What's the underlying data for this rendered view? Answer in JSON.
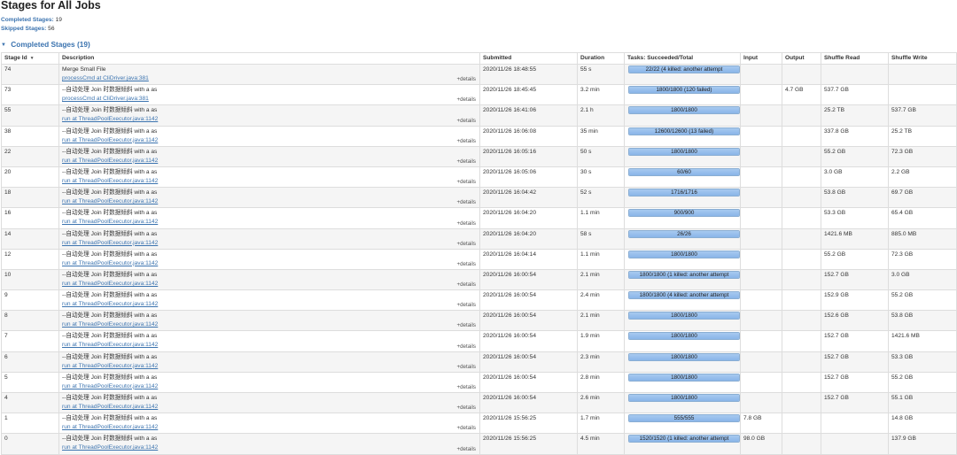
{
  "page": {
    "title": "Stages for All Jobs",
    "summary": [
      {
        "label": "Completed Stages:",
        "value": "19"
      },
      {
        "label": "Skipped Stages:",
        "value": "56"
      }
    ],
    "section_title": "Completed Stages (19)"
  },
  "table": {
    "columns": [
      "Stage Id",
      "Description",
      "Submitted",
      "Duration",
      "Tasks: Succeeded/Total",
      "Input",
      "Output",
      "Shuffle Read",
      "Shuffle Write"
    ],
    "details_label": "+details",
    "rows": [
      {
        "id": "74",
        "desc1": "Merge Small File",
        "desc2": "processCmd at CliDriver.java:381",
        "submitted": "2020/11/26 18:48:55",
        "duration": "55 s",
        "tasks": "22/22 (4 killed: another attempt",
        "progress": 1.0,
        "input": "",
        "output": "",
        "shuffle_read": "",
        "shuffle_write": ""
      },
      {
        "id": "73",
        "desc1": "--自动处理 Join 时数据倾斜 with a as",
        "desc2": "processCmd at CliDriver.java:381",
        "submitted": "2020/11/26 18:45:45",
        "duration": "3.2 min",
        "tasks": "1800/1800 (120 failed)",
        "progress": 1.0,
        "input": "",
        "output": "4.7 GB",
        "shuffle_read": "537.7 GB",
        "shuffle_write": ""
      },
      {
        "id": "55",
        "desc1": "--自动处理 Join 时数据倾斜 with a as",
        "desc2": "run at ThreadPoolExecutor.java:1142",
        "submitted": "2020/11/26 16:41:06",
        "duration": "2.1 h",
        "tasks": "1800/1800",
        "progress": 1.0,
        "input": "",
        "output": "",
        "shuffle_read": "25.2 TB",
        "shuffle_write": "537.7 GB"
      },
      {
        "id": "38",
        "desc1": "--自动处理 Join 时数据倾斜 with a as",
        "desc2": "run at ThreadPoolExecutor.java:1142",
        "submitted": "2020/11/26 16:06:08",
        "duration": "35 min",
        "tasks": "12600/12600 (13 failed)",
        "progress": 1.0,
        "input": "",
        "output": "",
        "shuffle_read": "337.8 GB",
        "shuffle_write": "25.2 TB"
      },
      {
        "id": "22",
        "desc1": "--自动处理 Join 时数据倾斜 with a as",
        "desc2": "run at ThreadPoolExecutor.java:1142",
        "submitted": "2020/11/26 16:05:16",
        "duration": "50 s",
        "tasks": "1800/1800",
        "progress": 1.0,
        "input": "",
        "output": "",
        "shuffle_read": "55.2 GB",
        "shuffle_write": "72.3 GB"
      },
      {
        "id": "20",
        "desc1": "--自动处理 Join 时数据倾斜 with a as",
        "desc2": "run at ThreadPoolExecutor.java:1142",
        "submitted": "2020/11/26 16:05:06",
        "duration": "30 s",
        "tasks": "60/60",
        "progress": 1.0,
        "input": "",
        "output": "",
        "shuffle_read": "3.0 GB",
        "shuffle_write": "2.2 GB"
      },
      {
        "id": "18",
        "desc1": "--自动处理 Join 时数据倾斜 with a as",
        "desc2": "run at ThreadPoolExecutor.java:1142",
        "submitted": "2020/11/26 16:04:42",
        "duration": "52 s",
        "tasks": "1716/1716",
        "progress": 1.0,
        "input": "",
        "output": "",
        "shuffle_read": "53.8 GB",
        "shuffle_write": "69.7 GB"
      },
      {
        "id": "16",
        "desc1": "--自动处理 Join 时数据倾斜 with a as",
        "desc2": "run at ThreadPoolExecutor.java:1142",
        "submitted": "2020/11/26 16:04:20",
        "duration": "1.1 min",
        "tasks": "900/900",
        "progress": 1.0,
        "input": "",
        "output": "",
        "shuffle_read": "53.3 GB",
        "shuffle_write": "65.4 GB"
      },
      {
        "id": "14",
        "desc1": "--自动处理 Join 时数据倾斜 with a as",
        "desc2": "run at ThreadPoolExecutor.java:1142",
        "submitted": "2020/11/26 16:04:20",
        "duration": "58 s",
        "tasks": "26/26",
        "progress": 1.0,
        "input": "",
        "output": "",
        "shuffle_read": "1421.6 MB",
        "shuffle_write": "885.0 MB"
      },
      {
        "id": "12",
        "desc1": "--自动处理 Join 时数据倾斜 with a as",
        "desc2": "run at ThreadPoolExecutor.java:1142",
        "submitted": "2020/11/26 16:04:14",
        "duration": "1.1 min",
        "tasks": "1800/1800",
        "progress": 1.0,
        "input": "",
        "output": "",
        "shuffle_read": "55.2 GB",
        "shuffle_write": "72.3 GB"
      },
      {
        "id": "10",
        "desc1": "--自动处理 Join 时数据倾斜 with a as",
        "desc2": "run at ThreadPoolExecutor.java:1142",
        "submitted": "2020/11/26 16:00:54",
        "duration": "2.1 min",
        "tasks": "1800/1800 (1 killed: another attempt",
        "progress": 1.0,
        "input": "",
        "output": "",
        "shuffle_read": "152.7 GB",
        "shuffle_write": "3.0 GB"
      },
      {
        "id": "9",
        "desc1": "--自动处理 Join 时数据倾斜 with a as",
        "desc2": "run at ThreadPoolExecutor.java:1142",
        "submitted": "2020/11/26 16:00:54",
        "duration": "2.4 min",
        "tasks": "1800/1800 (4 killed: another attempt",
        "progress": 1.0,
        "input": "",
        "output": "",
        "shuffle_read": "152.9 GB",
        "shuffle_write": "55.2 GB"
      },
      {
        "id": "8",
        "desc1": "--自动处理 Join 时数据倾斜 with a as",
        "desc2": "run at ThreadPoolExecutor.java:1142",
        "submitted": "2020/11/26 16:00:54",
        "duration": "2.1 min",
        "tasks": "1800/1800",
        "progress": 1.0,
        "input": "",
        "output": "",
        "shuffle_read": "152.6 GB",
        "shuffle_write": "53.8 GB"
      },
      {
        "id": "7",
        "desc1": "--自动处理 Join 时数据倾斜 with a as",
        "desc2": "run at ThreadPoolExecutor.java:1142",
        "submitted": "2020/11/26 16:00:54",
        "duration": "1.9 min",
        "tasks": "1800/1800",
        "progress": 1.0,
        "input": "",
        "output": "",
        "shuffle_read": "152.7 GB",
        "shuffle_write": "1421.6 MB"
      },
      {
        "id": "6",
        "desc1": "--自动处理 Join 时数据倾斜 with a as",
        "desc2": "run at ThreadPoolExecutor.java:1142",
        "submitted": "2020/11/26 16:00:54",
        "duration": "2.3 min",
        "tasks": "1800/1800",
        "progress": 1.0,
        "input": "",
        "output": "",
        "shuffle_read": "152.7 GB",
        "shuffle_write": "53.3 GB"
      },
      {
        "id": "5",
        "desc1": "--自动处理 Join 时数据倾斜 with a as",
        "desc2": "run at ThreadPoolExecutor.java:1142",
        "submitted": "2020/11/26 16:00:54",
        "duration": "2.8 min",
        "tasks": "1800/1800",
        "progress": 1.0,
        "input": "",
        "output": "",
        "shuffle_read": "152.7 GB",
        "shuffle_write": "55.2 GB"
      },
      {
        "id": "4",
        "desc1": "--自动处理 Join 时数据倾斜 with a as",
        "desc2": "run at ThreadPoolExecutor.java:1142",
        "submitted": "2020/11/26 16:00:54",
        "duration": "2.6 min",
        "tasks": "1800/1800",
        "progress": 1.0,
        "input": "",
        "output": "",
        "shuffle_read": "152.7 GB",
        "shuffle_write": "55.1 GB"
      },
      {
        "id": "1",
        "desc1": "--自动处理 Join 时数据倾斜 with a as",
        "desc2": "run at ThreadPoolExecutor.java:1142",
        "submitted": "2020/11/26 15:56:25",
        "duration": "1.7 min",
        "tasks": "555/555",
        "progress": 1.0,
        "input": "7.8 GB",
        "output": "",
        "shuffle_read": "",
        "shuffle_write": "14.8 GB"
      },
      {
        "id": "0",
        "desc1": "--自动处理 Join 时数据倾斜 with a as",
        "desc2": "run at ThreadPoolExecutor.java:1142",
        "submitted": "2020/11/26 15:56:25",
        "duration": "4.5 min",
        "tasks": "1520/1520 (1 killed: another attempt",
        "progress": 1.0,
        "input": "98.0 GB",
        "output": "",
        "shuffle_read": "",
        "shuffle_write": "137.9 GB"
      }
    ]
  },
  "colors": {
    "link": "#3b73af",
    "progress_fill": "#8ab5e8",
    "row_stripe": "#f5f5f5",
    "border": "#dddddd"
  },
  "icons": {
    "sort": "sort-desc-icon",
    "collapse": "collapse-arrow-icon"
  }
}
